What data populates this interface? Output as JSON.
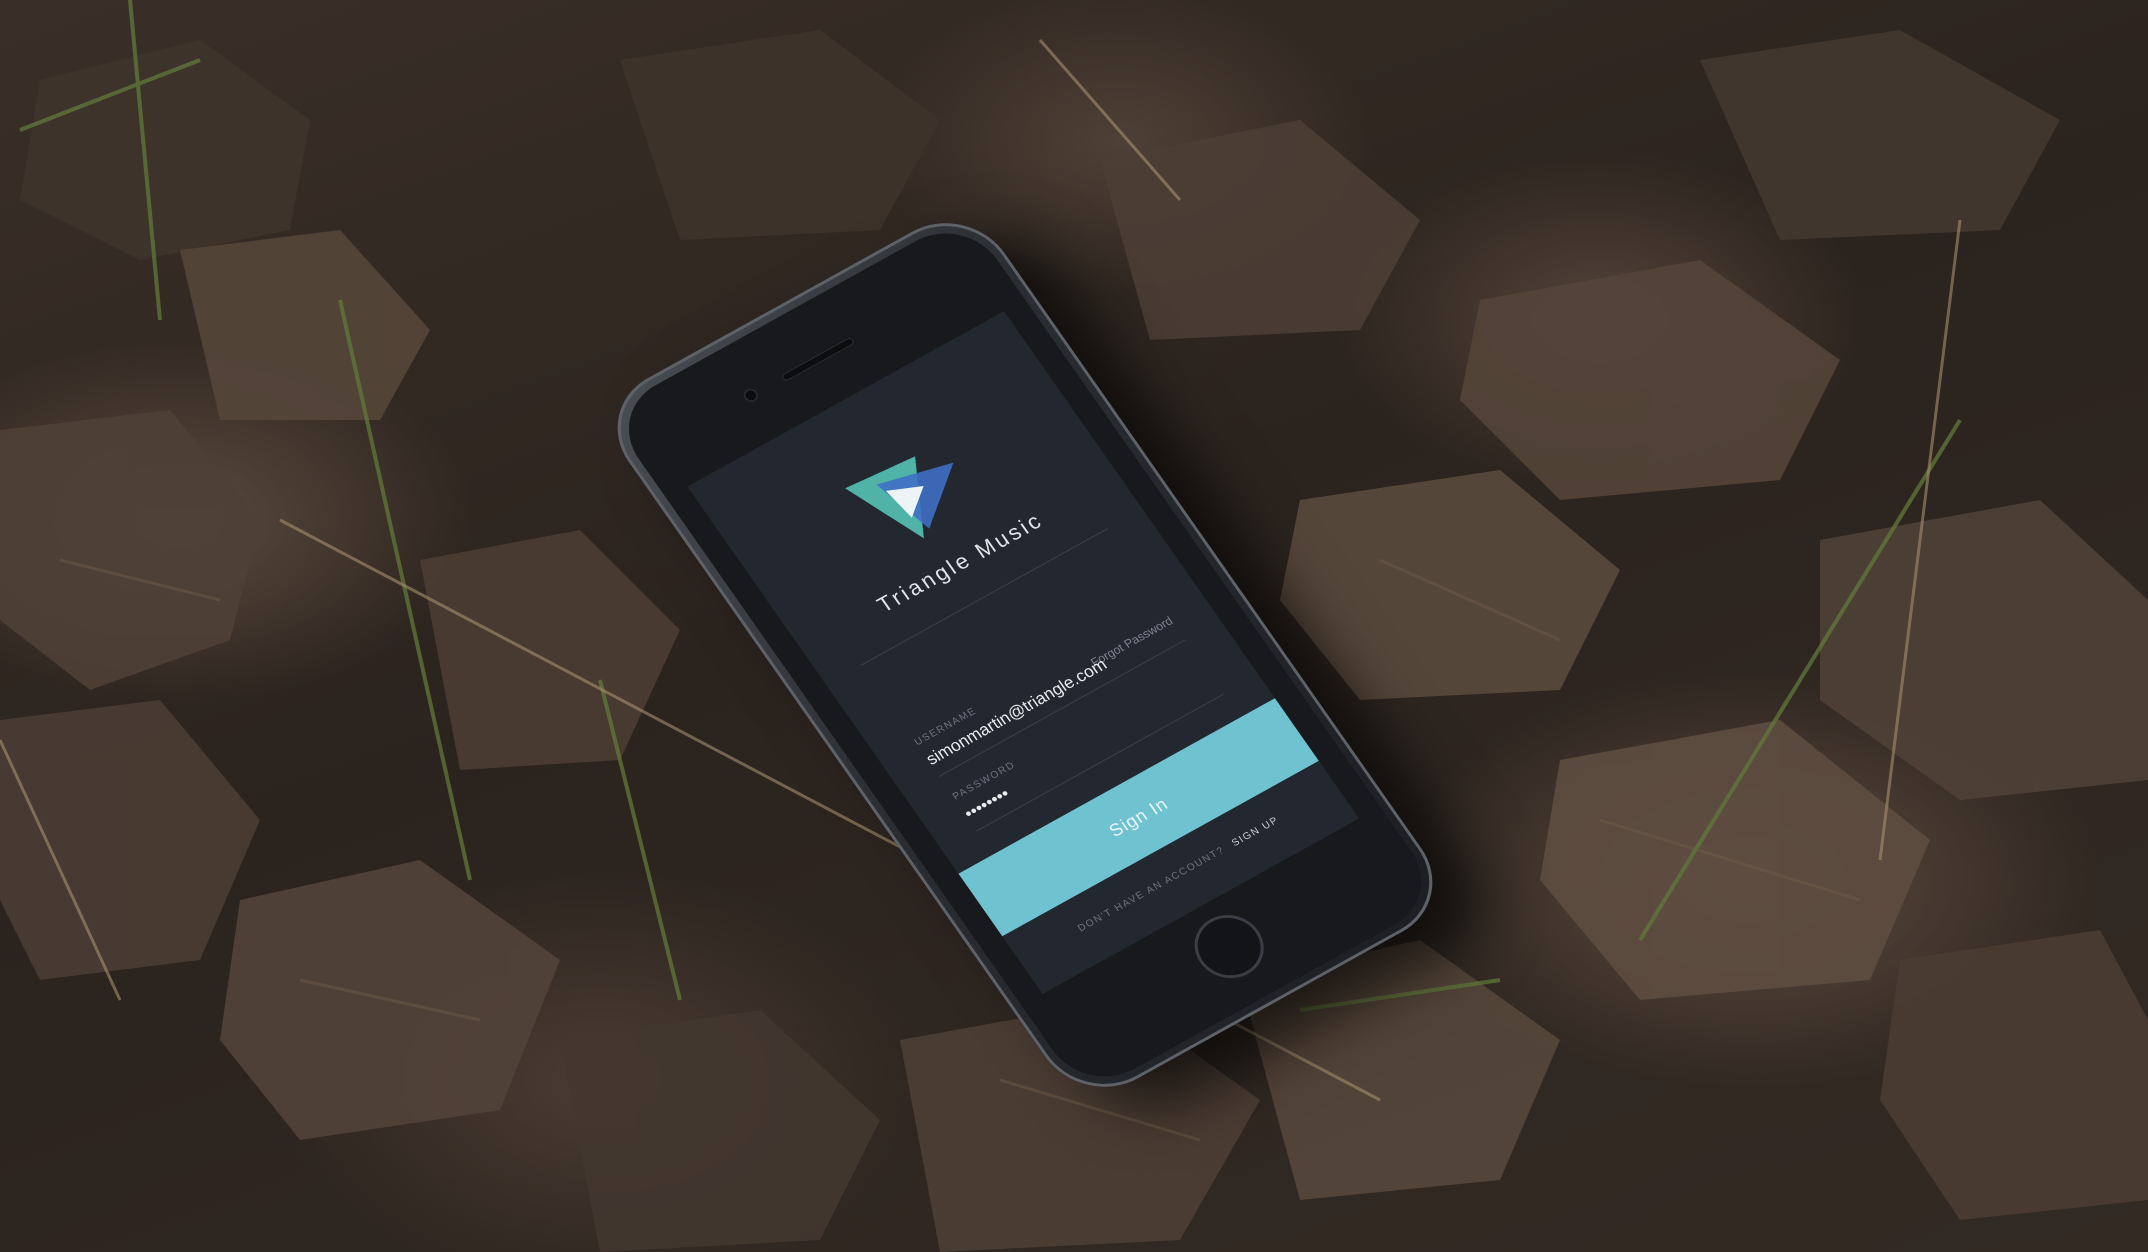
{
  "app": {
    "name": "Triangle Music"
  },
  "login": {
    "username_label": "USERNAME",
    "username_value": "simonmartin@triangle.com",
    "password_label": "PASSWORD",
    "password_value": "••••••••",
    "forgot_label": "Forgot Password",
    "signin_label": "Sign In",
    "no_account_label": "DON'T HAVE AN ACCOUNT?",
    "signup_label": "SIGN UP"
  },
  "colors": {
    "accent": "#6fc2cf",
    "screen_bg": "#23272f",
    "logo_teal": "#4fb3a8",
    "logo_blue": "#3f6fc4"
  }
}
